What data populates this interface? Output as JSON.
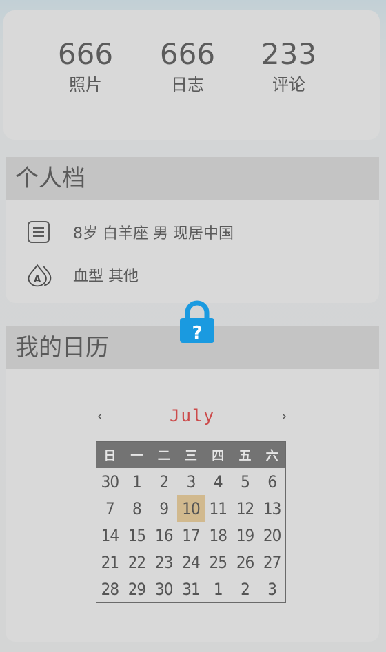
{
  "stats": [
    {
      "value": "666",
      "label": "照片"
    },
    {
      "value": "666",
      "label": "日志"
    },
    {
      "value": "233",
      "label": "评论"
    }
  ],
  "profile": {
    "title": "个人档",
    "rows": [
      {
        "icon": "document-icon",
        "text": "8岁 白羊座 男 现居中国"
      },
      {
        "icon": "blood-type-icon",
        "text": "血型 其他"
      }
    ]
  },
  "lock": {
    "icon": "lock-question-icon",
    "color": "#1a9ae0"
  },
  "calendar": {
    "title": "我的日历",
    "prev": "‹",
    "next": "›",
    "month": "July",
    "weekdays": [
      "日",
      "一",
      "二",
      "三",
      "四",
      "五",
      "六"
    ],
    "weeks": [
      [
        "30",
        "1",
        "2",
        "3",
        "4",
        "5",
        "6"
      ],
      [
        "7",
        "8",
        "9",
        "10",
        "11",
        "12",
        "13"
      ],
      [
        "14",
        "15",
        "16",
        "17",
        "18",
        "19",
        "20"
      ],
      [
        "21",
        "22",
        "23",
        "24",
        "25",
        "26",
        "27"
      ],
      [
        "28",
        "29",
        "30",
        "31",
        "1",
        "2",
        "3"
      ]
    ],
    "today": "10",
    "colors": {
      "month": "#cc4a4a",
      "today_bg": "#d1b98e",
      "header_bg": "#737373"
    }
  }
}
